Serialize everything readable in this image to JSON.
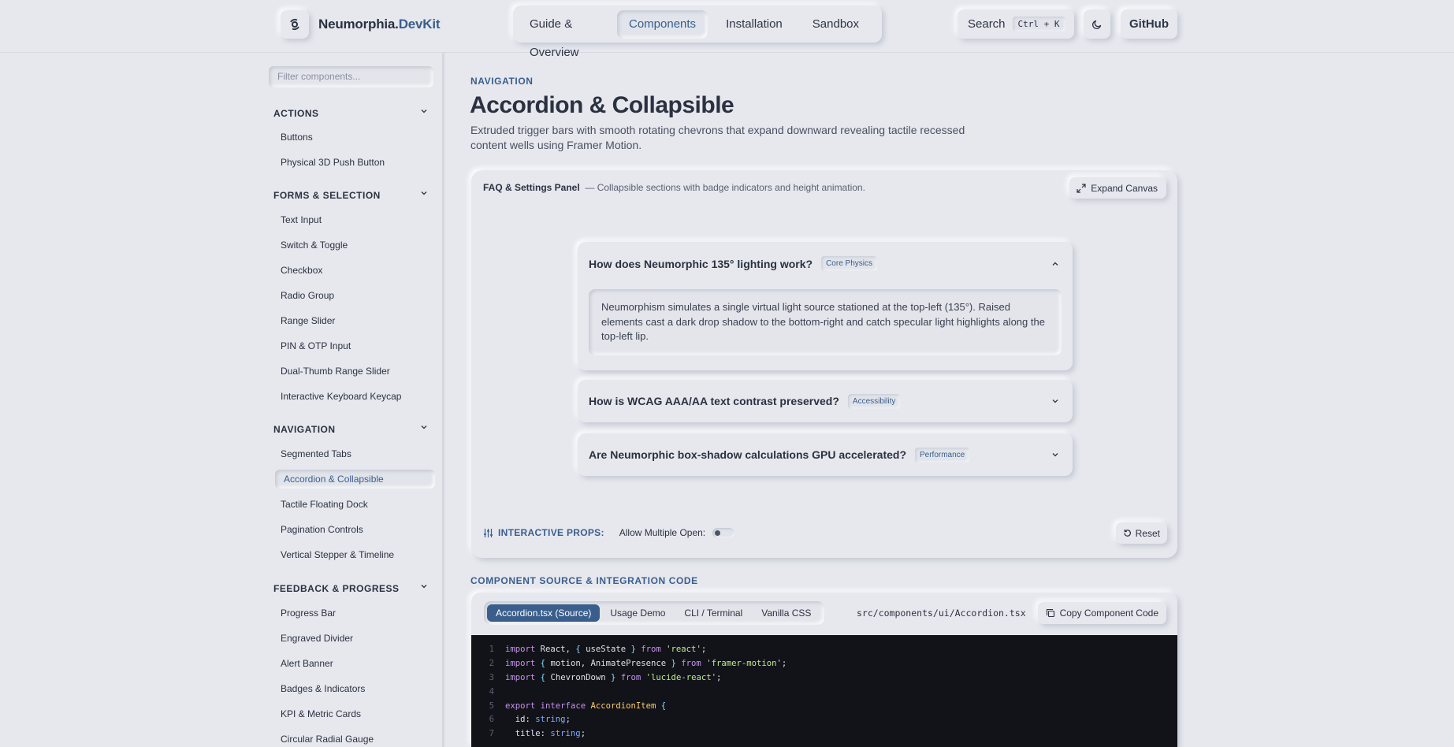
{
  "header": {
    "brand_part1": "Neumorphia.",
    "brand_part2": "DevKit",
    "nav": [
      "Guide & Overview",
      "Components",
      "Installation",
      "Sandbox"
    ],
    "active_nav": "Components",
    "search_label": "Search",
    "search_shortcut": "Ctrl + K",
    "github_label": "GitHub"
  },
  "sidebar": {
    "filter_placeholder": "Filter components...",
    "groups": [
      {
        "title": "ACTIONS",
        "items": [
          "Buttons",
          "Physical 3D Push Button"
        ]
      },
      {
        "title": "FORMS & SELECTION",
        "items": [
          "Text Input",
          "Switch & Toggle",
          "Checkbox",
          "Radio Group",
          "Range Slider",
          "PIN & OTP Input",
          "Dual-Thumb Range Slider",
          "Interactive Keyboard Keycap"
        ]
      },
      {
        "title": "NAVIGATION",
        "items": [
          "Segmented Tabs",
          "Accordion & Collapsible",
          "Tactile Floating Dock",
          "Pagination Controls",
          "Vertical Stepper & Timeline"
        ]
      },
      {
        "title": "FEEDBACK & PROGRESS",
        "items": [
          "Progress Bar",
          "Engraved Divider",
          "Alert Banner",
          "Badges & Indicators",
          "KPI & Metric Cards",
          "Circular Radial Gauge"
        ]
      }
    ],
    "active_item": "Accordion & Collapsible"
  },
  "main": {
    "eyebrow": "NAVIGATION",
    "title": "Accordion & Collapsible",
    "description": "Extruded trigger bars with smooth rotating chevrons that expand downward revealing tactile recessed content wells using Framer Motion.",
    "panel": {
      "title": "FAQ & Settings Panel",
      "subtitle": "— Collapsible sections with badge indicators and height animation.",
      "expand_label": "Expand Canvas",
      "accordion": [
        {
          "question": "How does Neumorphic 135° lighting work?",
          "badge": "Core Physics",
          "open": true,
          "answer": "Neumorphism simulates a single virtual light source stationed at the top-left (135°). Raised elements cast a dark drop shadow to the bottom-right and catch specular light highlights along the top-left lip."
        },
        {
          "question": "How is WCAG AAA/AA text contrast preserved?",
          "badge": "Accessibility",
          "open": false
        },
        {
          "question": "Are Neumorphic box-shadow calculations GPU accelerated?",
          "badge": "Performance",
          "open": false
        }
      ],
      "props_label": "INTERACTIVE PROPS:",
      "allow_multiple_label": "Allow Multiple Open:",
      "allow_multiple_value": false,
      "reset_label": "Reset"
    },
    "code_section": {
      "label": "COMPONENT SOURCE & INTEGRATION CODE",
      "tabs": [
        "Accordion.tsx (Source)",
        "Usage Demo",
        "CLI / Terminal",
        "Vanilla CSS"
      ],
      "active_tab": "Accordion.tsx (Source)",
      "file_path": "src/components/ui/Accordion.tsx",
      "copy_label": "Copy Component Code",
      "lines": [
        "import React, { useState } from 'react';",
        "import { motion, AnimatePresence } from 'framer-motion';",
        "import { ChevronDown } from 'lucide-react';",
        "",
        "export interface AccordionItem {",
        "  id: string;",
        "  title: string;"
      ]
    }
  },
  "colors": {
    "background": "#e6e8ee",
    "accent": "#3a5e8c",
    "code_background": "#111319"
  }
}
